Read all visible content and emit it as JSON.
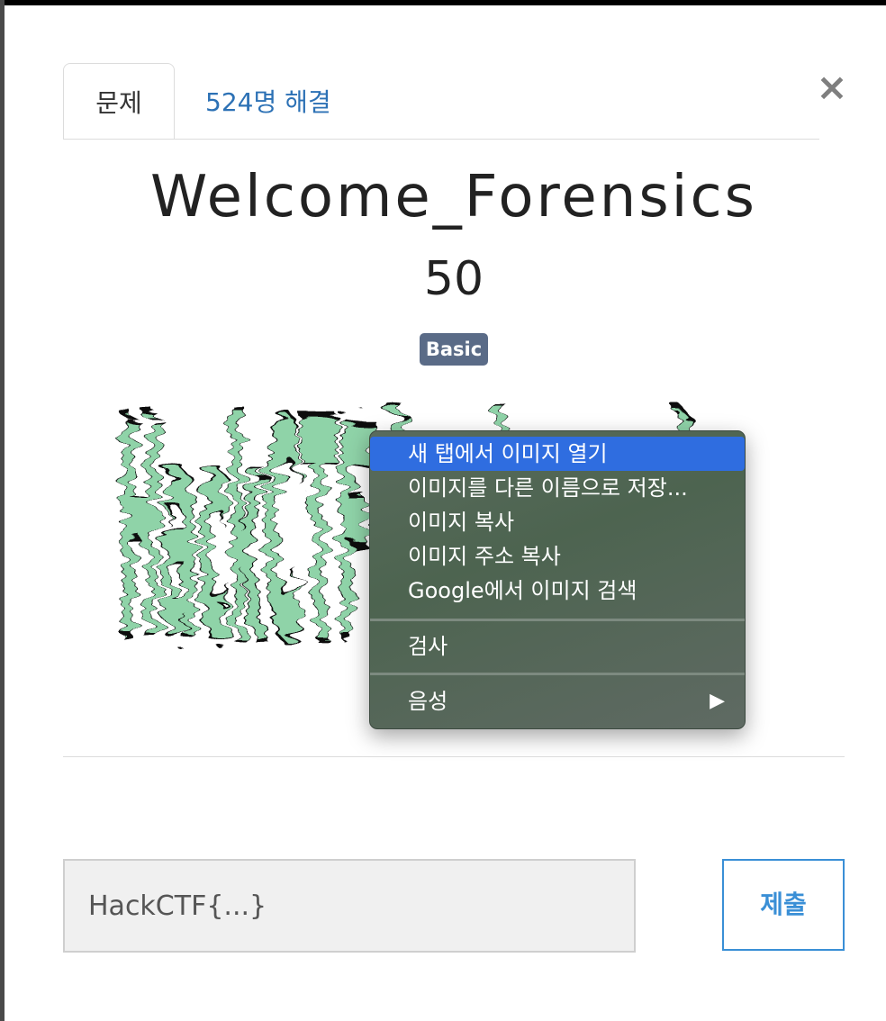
{
  "tabs": {
    "problem": "문제",
    "solved": "524명 해결"
  },
  "close_glyph": "×",
  "challenge": {
    "title": "Welcome_Forensics",
    "points": "50",
    "category": "Basic",
    "image_text": "HackCTF{welcome}"
  },
  "context_menu": {
    "items": [
      "새 탭에서 이미지 열기",
      "이미지를 다른 이름으로 저장...",
      "이미지 복사",
      "이미지 주소 복사",
      "Google에서 이미지 검색"
    ],
    "inspect": "검사",
    "speech": "음성",
    "submenu_arrow": "▶"
  },
  "flag_form": {
    "placeholder": "HackCTF{...}",
    "submit_label": "제출"
  },
  "colors": {
    "link": "#2c71b5",
    "badge": "#5a6b87",
    "menu_highlight": "#2f6de0",
    "submit_border": "#3a8fd6",
    "image_fill": "#8fd3a8"
  }
}
